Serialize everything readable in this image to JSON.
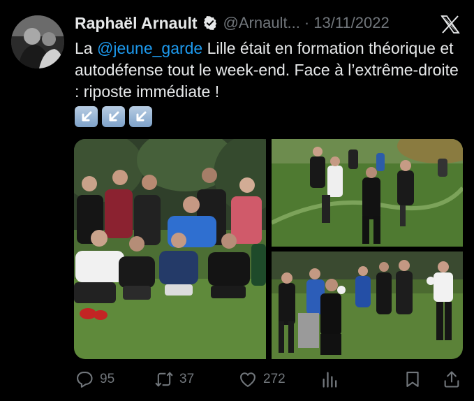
{
  "tweet": {
    "author_name": "Raphaël Arnault",
    "handle": "@Arnault...",
    "separator": "·",
    "date": "13/11/2022",
    "text_prefix": "La ",
    "mention": "@jeune_garde",
    "text_rest": " Lille était en formation théorique et autodéfense tout le week-end. Face à l’extrême-droite : riposte immédiate !"
  },
  "emojis": [
    "down-left-arrow-icon",
    "down-left-arrow-icon",
    "down-left-arrow-icon"
  ],
  "stats": {
    "replies": "95",
    "reposts": "37",
    "likes": "272"
  },
  "colors": {
    "background": "#000000",
    "text": "#e7e9ea",
    "secondary": "#71767b",
    "link": "#1d9bf0"
  }
}
